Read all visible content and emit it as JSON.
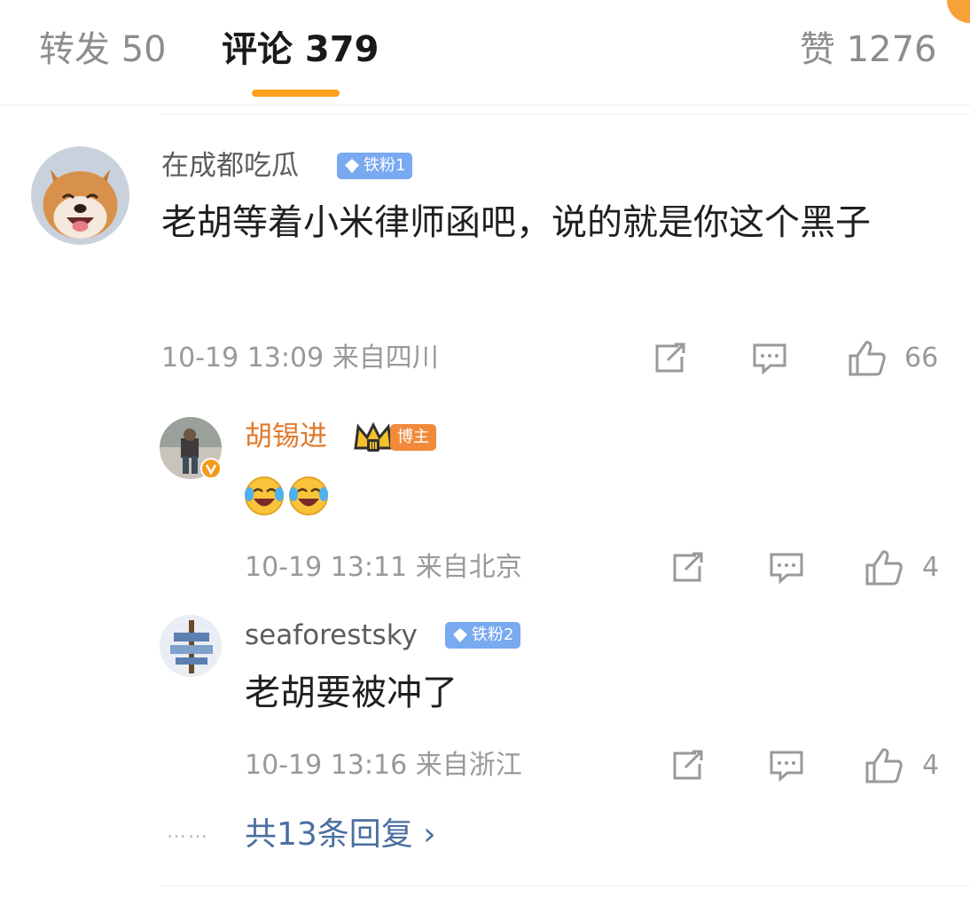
{
  "tabs": {
    "repost": "转发 50",
    "comments": "评论 379",
    "likes": "赞 1276"
  },
  "comment": {
    "username": "在成都吃瓜",
    "badge": "铁粉1",
    "text": "老胡等着小米律师函吧，说的就是你这个黑子",
    "time": "10-19 13:09",
    "location": "来自四川",
    "likes": "66"
  },
  "replies": [
    {
      "username": "胡锡进",
      "badge": "博主",
      "text": "",
      "time": "10-19 13:11",
      "location": "来自北京",
      "likes": "4"
    },
    {
      "username": "seaforestsky",
      "badge": "铁粉2",
      "text": "老胡要被冲了",
      "time": "10-19 13:16",
      "location": "来自浙江",
      "likes": "4"
    }
  ],
  "more_replies": "共13条回复 ›",
  "more_dots": "……",
  "colors": {
    "accent": "#ff9f1a",
    "fan_badge": "#79a9f0",
    "author": "#e0792b",
    "link": "#4a6fa0"
  }
}
